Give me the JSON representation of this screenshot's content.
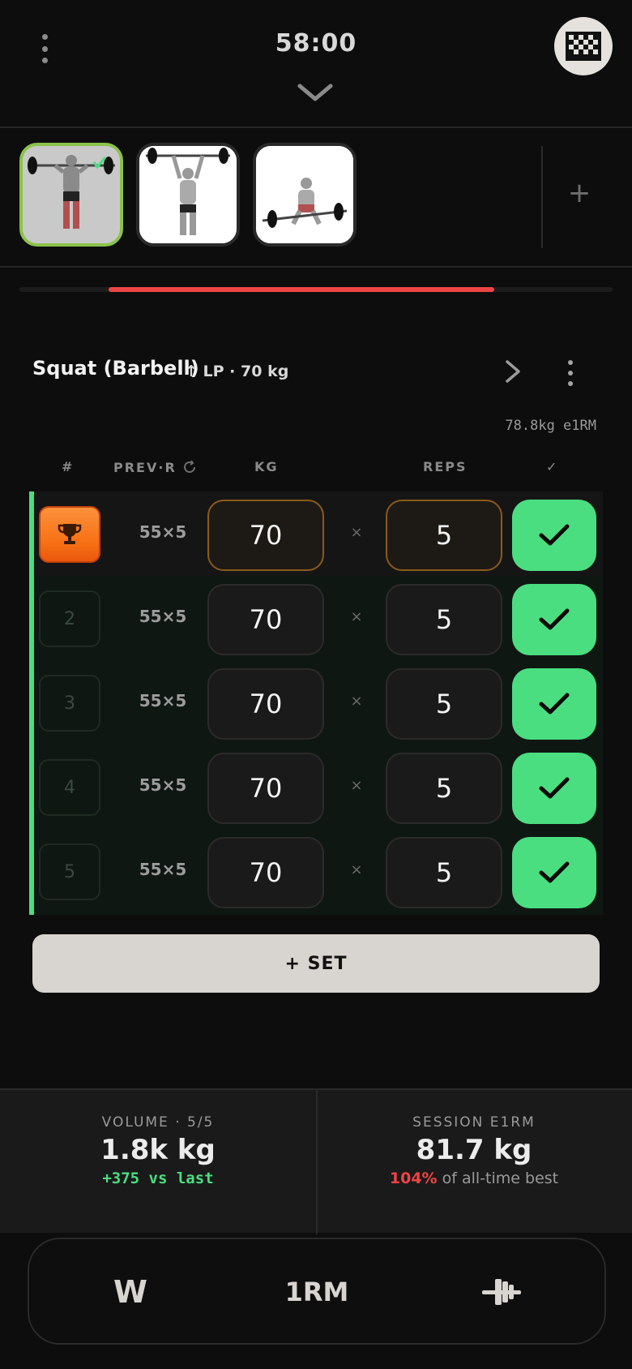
{
  "header": {
    "timer": "58:00",
    "menu_icon": "vertical-dots-icon",
    "collapse_icon": "chevron-down-icon",
    "finish_icon": "checkered-flag-icon"
  },
  "exercise_strip": {
    "items": [
      {
        "name": "overhead-press",
        "active": true
      },
      {
        "name": "barbell-overhead-hold",
        "active": false
      },
      {
        "name": "deadlift",
        "active": false
      }
    ],
    "add_label": "+"
  },
  "progress": {
    "fraction_start": 0.15,
    "fraction_end": 0.8,
    "color": "#ef4444"
  },
  "exercise": {
    "title": "Squat (Barbell)",
    "meta": "↑ LP · 70 kg",
    "e1rm_badge": "78.8kg e1RM"
  },
  "columns": {
    "num": "#",
    "prev": "PREV·R",
    "kg": "KG",
    "reps": "REPS",
    "done": "✓"
  },
  "sets": [
    {
      "num": "",
      "pr": true,
      "prev": "55×5",
      "kg": "70",
      "times": "×",
      "reps": "5"
    },
    {
      "num": "2",
      "pr": false,
      "prev": "55×5",
      "kg": "70",
      "times": "×",
      "reps": "5"
    },
    {
      "num": "3",
      "pr": false,
      "prev": "55×5",
      "kg": "70",
      "times": "×",
      "reps": "5"
    },
    {
      "num": "4",
      "pr": false,
      "prev": "55×5",
      "kg": "70",
      "times": "×",
      "reps": "5"
    },
    {
      "num": "5",
      "pr": false,
      "prev": "55×5",
      "kg": "70",
      "times": "×",
      "reps": "5"
    }
  ],
  "add_set_label": "+ SET",
  "stats": {
    "volume_label": "VOLUME · 5/5",
    "volume_value": "1.8k kg",
    "volume_delta": "+375 vs last",
    "e1rm_label": "SESSION E1RM",
    "e1rm_value": "81.7 kg",
    "e1rm_pct": "104%",
    "e1rm_pct_suffix": " of all-time best"
  },
  "dock": {
    "warmup_label": "W",
    "onerm_label": "1RM",
    "plates_icon": "barbell-plates-icon"
  },
  "colors": {
    "accent_green": "#4ade80",
    "accent_red": "#ef4444",
    "pr_orange": "#f97316",
    "active_border": "#8bc34a"
  }
}
